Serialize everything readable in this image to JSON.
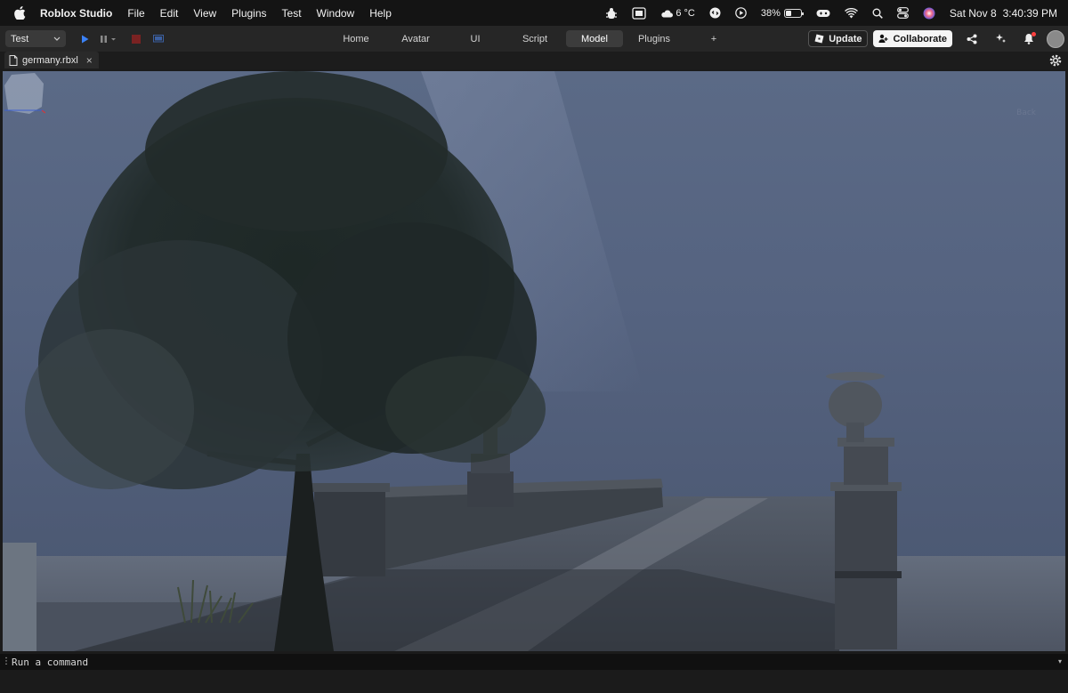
{
  "menubar": {
    "app_name": "Roblox Studio",
    "items": [
      "File",
      "Edit",
      "View",
      "Plugins",
      "Test",
      "Window",
      "Help"
    ],
    "weather": "6 °C",
    "battery_percent": "38%",
    "battery_level": 0.38,
    "date": "Sat Nov 8",
    "time": "3:40:39 PM"
  },
  "toolbar": {
    "mode": "Test",
    "tabs": [
      "Home",
      "Avatar",
      "UI",
      "Script",
      "Model",
      "Plugins"
    ],
    "active_tab": "Model",
    "add_tab_label": "+",
    "update_label": "Update",
    "collaborate_label": "Collaborate"
  },
  "file": {
    "name": "germany.rbxl",
    "close_label": "×"
  },
  "viewport": {
    "viewcube_label": "Back"
  },
  "command_bar": {
    "placeholder": "Run a command"
  },
  "colors": {
    "accent_play": "#3b82f6",
    "stop_red": "#c0392b",
    "sky": "#5b6a86"
  }
}
